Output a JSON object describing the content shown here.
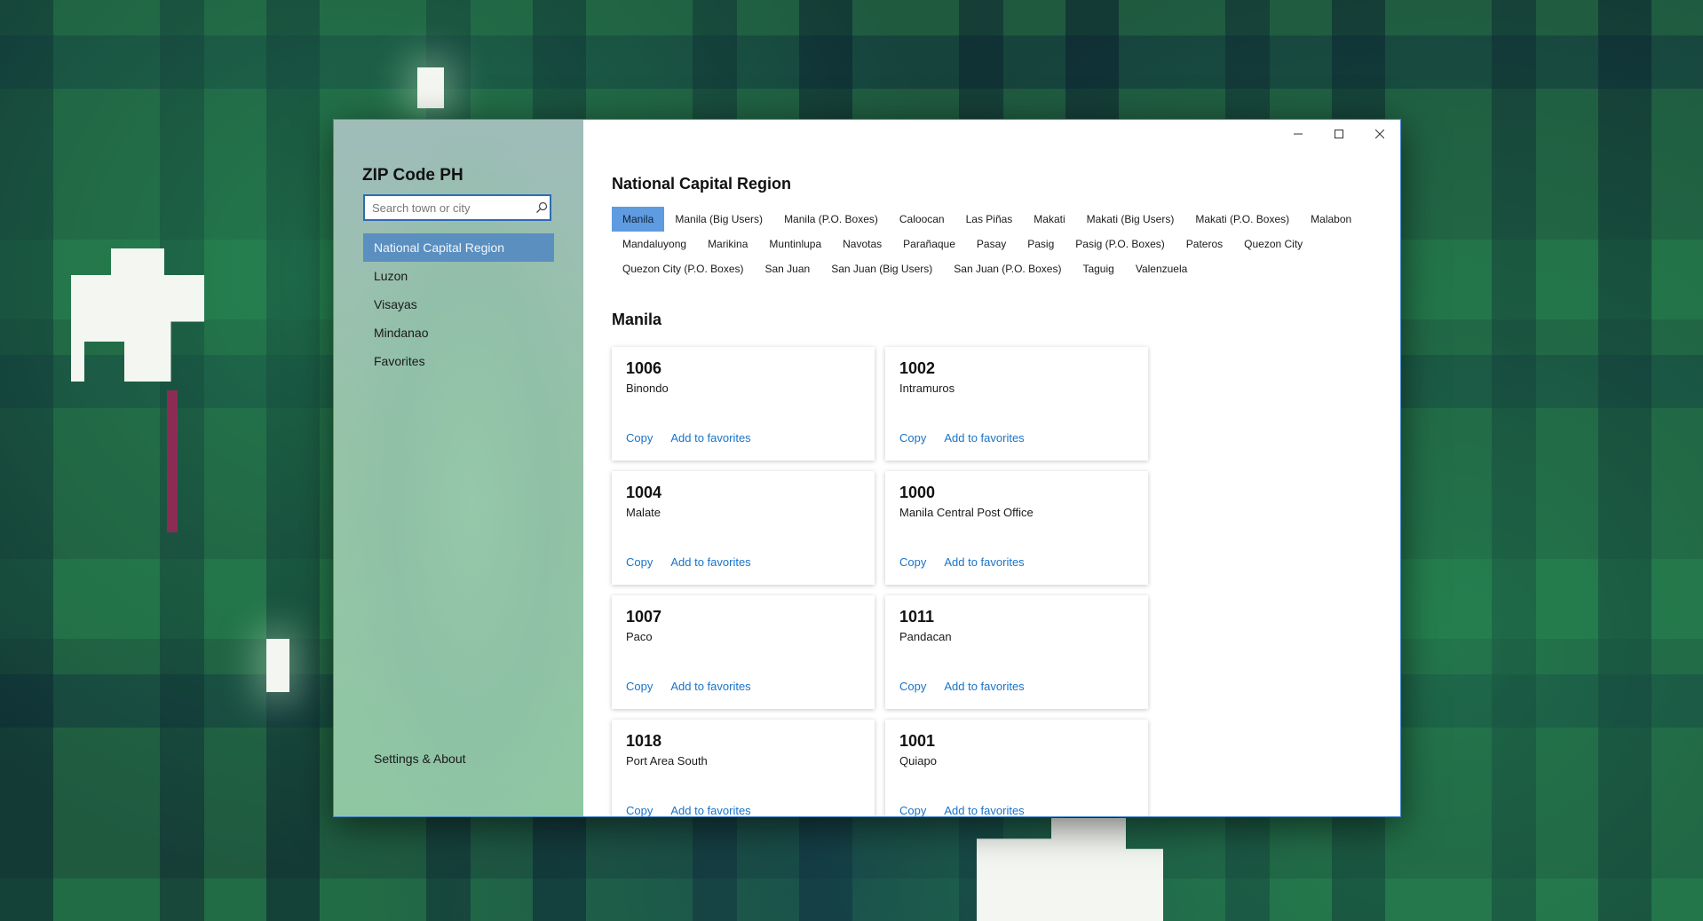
{
  "app": {
    "title": "ZIP Code PH",
    "search": {
      "placeholder": "Search town or city",
      "value": ""
    },
    "nav": [
      {
        "label": "National Capital Region",
        "active": true
      },
      {
        "label": "Luzon",
        "active": false
      },
      {
        "label": "Visayas",
        "active": false
      },
      {
        "label": "Mindanao",
        "active": false
      },
      {
        "label": "Favorites",
        "active": false
      }
    ],
    "settings_label": "Settings & About",
    "accent_color": "#5a8fc0",
    "link_color": "#1a73c8"
  },
  "window_controls": {
    "minimize_icon": "minimize-icon",
    "maximize_icon": "maximize-icon",
    "close_icon": "close-icon"
  },
  "main": {
    "region_title": "National Capital Region",
    "cities": [
      "Manila",
      "Manila (Big Users)",
      "Manila (P.O. Boxes)",
      "Caloocan",
      "Las Piñas",
      "Makati",
      "Makati (Big Users)",
      "Makati (P.O. Boxes)",
      "Malabon",
      "Mandaluyong",
      "Marikina",
      "Muntinlupa",
      "Navotas",
      "Parañaque",
      "Pasay",
      "Pasig",
      "Pasig (P.O. Boxes)",
      "Pateros",
      "Quezon City",
      "Quezon City (P.O. Boxes)",
      "San Juan",
      "San Juan (Big Users)",
      "San Juan (P.O. Boxes)",
      "Taguig",
      "Valenzuela"
    ],
    "selected_city": "Manila",
    "cards": [
      {
        "zip": "1006",
        "place": "Binondo"
      },
      {
        "zip": "1002",
        "place": "Intramuros"
      },
      {
        "zip": "1004",
        "place": "Malate"
      },
      {
        "zip": "1000",
        "place": "Manila Central Post Office"
      },
      {
        "zip": "1007",
        "place": "Paco"
      },
      {
        "zip": "1011",
        "place": "Pandacan"
      },
      {
        "zip": "1018",
        "place": "Port Area South"
      },
      {
        "zip": "1001",
        "place": "Quiapo"
      }
    ],
    "copy_label": "Copy",
    "favorite_label": "Add to favorites"
  }
}
